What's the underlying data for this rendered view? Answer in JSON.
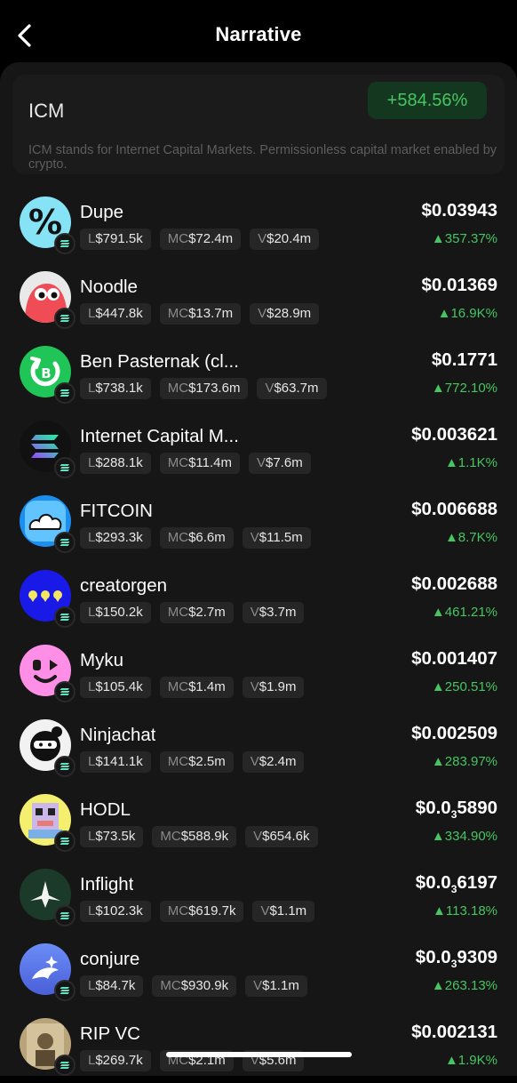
{
  "header": {
    "title": "Narrative",
    "back_icon": "chevron-left-icon"
  },
  "narrative": {
    "name": "ICM",
    "change": "+584.56%",
    "description": "ICM stands for Internet Capital Markets. Permissionless capital market enabled by crypto."
  },
  "colors": {
    "positive": "#46c561",
    "badge_bg": "#14371f",
    "sheet_bg": "#161616",
    "chip_bg": "#262626"
  },
  "tokens": [
    {
      "name": "Dupe",
      "liquidity": "$791.5k",
      "mcap": "$72.4m",
      "volume": "$20.4m",
      "price": "$0.03943",
      "change": "357.37%"
    },
    {
      "name": "Noodle",
      "liquidity": "$447.8k",
      "mcap": "$13.7m",
      "volume": "$28.9m",
      "price": "$0.01369",
      "change": "16.9K%"
    },
    {
      "name": "Ben Pasternak (cl...",
      "liquidity": "$738.1k",
      "mcap": "$173.6m",
      "volume": "$63.7m",
      "price": "$0.1771",
      "change": "772.10%"
    },
    {
      "name": "Internet Capital M...",
      "liquidity": "$288.1k",
      "mcap": "$11.4m",
      "volume": "$7.6m",
      "price": "$0.003621",
      "change": "1.1K%"
    },
    {
      "name": "FITCOIN",
      "liquidity": "$293.3k",
      "mcap": "$6.6m",
      "volume": "$11.5m",
      "price": "$0.006688",
      "change": "8.7K%"
    },
    {
      "name": "creatorgen",
      "liquidity": "$150.2k",
      "mcap": "$2.7m",
      "volume": "$3.7m",
      "price": "$0.002688",
      "change": "461.21%"
    },
    {
      "name": "Myku",
      "liquidity": "$105.4k",
      "mcap": "$1.4m",
      "volume": "$1.9m",
      "price": "$0.001407",
      "change": "250.51%"
    },
    {
      "name": "Ninjachat",
      "liquidity": "$141.1k",
      "mcap": "$2.5m",
      "volume": "$2.4m",
      "price": "$0.002509",
      "change": "283.97%"
    },
    {
      "name": "HODL",
      "liquidity": "$73.5k",
      "mcap": "$588.9k",
      "volume": "$654.6k",
      "price_prefix": "$0.0",
      "price_zeros": "3",
      "price_digits": "5890",
      "change": "334.90%"
    },
    {
      "name": "Inflight",
      "liquidity": "$102.3k",
      "mcap": "$619.7k",
      "volume": "$1.1m",
      "price_prefix": "$0.0",
      "price_zeros": "3",
      "price_digits": "6197",
      "change": "113.18%"
    },
    {
      "name": "conjure",
      "liquidity": "$84.7k",
      "mcap": "$930.9k",
      "volume": "$1.1m",
      "price_prefix": "$0.0",
      "price_zeros": "3",
      "price_digits": "9309",
      "change": "263.13%"
    },
    {
      "name": "RIP VC",
      "liquidity": "$269.7k",
      "mcap": "$2.1m",
      "volume": "$5.6m",
      "price": "$0.002131",
      "change": "1.9K%"
    }
  ],
  "labels": {
    "liquidity": "L",
    "mcap": "MC",
    "volume": "V",
    "up_arrow": "▲"
  }
}
